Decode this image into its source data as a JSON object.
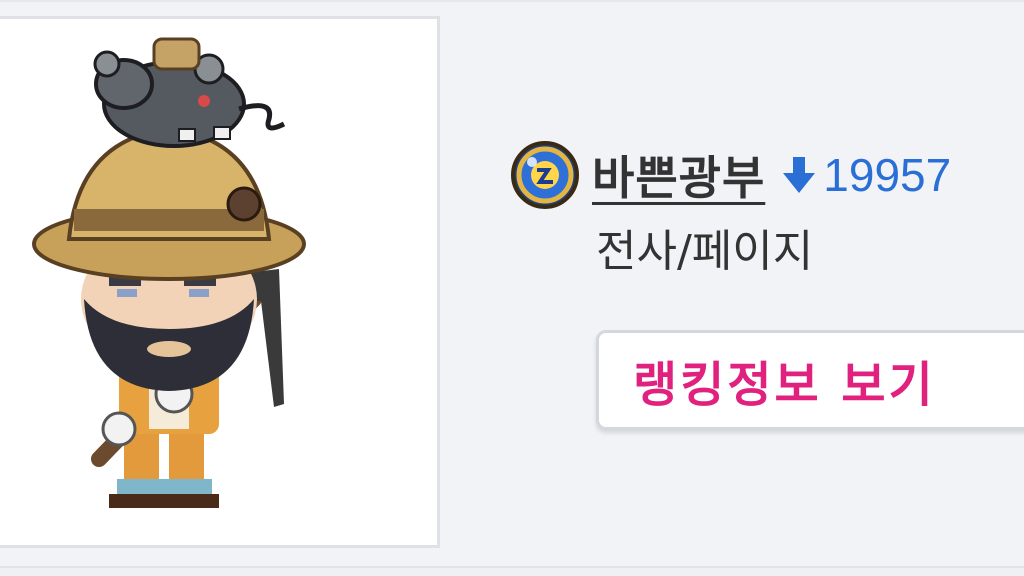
{
  "character": {
    "name": "바쁜광부",
    "job": "전사/페이지",
    "rank_change": "19957",
    "rank_direction": "down",
    "guild_emblem_icon": "guild-emblem-icon",
    "avatar_icon": "miner-avatar-icon"
  },
  "actions": {
    "ranking_button_label": "랭킹정보 보기"
  },
  "colors": {
    "background": "#f2f3f7",
    "name_text": "#333333",
    "rank_change_blue": "#2a6fd6",
    "button_text_pink": "#e0217d"
  }
}
